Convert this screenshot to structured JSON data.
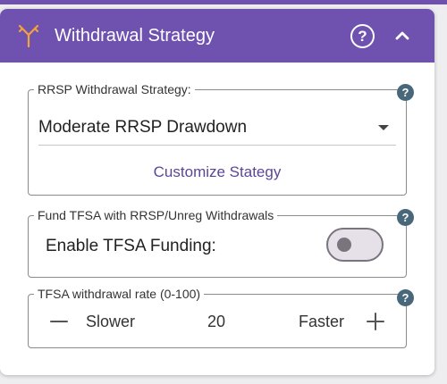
{
  "header": {
    "title": "Withdrawal Strategy",
    "icon": "fork-icon",
    "help_glyph": "?",
    "collapse_icon": "chevron-up-icon",
    "color": "#6f52b0"
  },
  "rrsp": {
    "legend": "RRSP Withdrawal Strategy:",
    "selected": "Moderate RRSP Drawdown",
    "customize_label": "Customize Stategy",
    "help_glyph": "?"
  },
  "tfsa_funding": {
    "legend": "Fund TFSA with RRSP/Unreg Withdrawals",
    "toggle_label": "Enable TFSA Funding:",
    "enabled": false,
    "help_glyph": "?"
  },
  "tfsa_rate": {
    "legend": "TFSA withdrawal rate (0-100)",
    "slower_label": "Slower",
    "value": "20",
    "faster_label": "Faster",
    "help_glyph": "?"
  },
  "colors": {
    "accent": "#6f52b0",
    "link": "#5c4599",
    "help_badge": "#49677a"
  }
}
